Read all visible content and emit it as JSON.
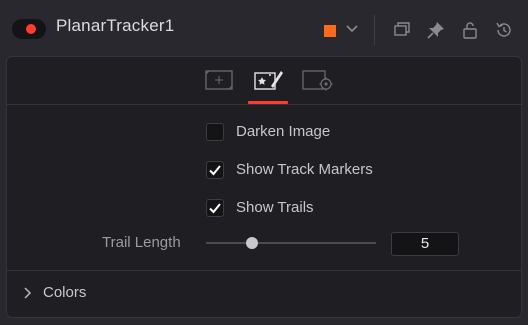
{
  "node": {
    "title": "PlanarTracker1",
    "accent_color": "#ff3b2f",
    "swatch_color": "#ff6a1a"
  },
  "header_icons": [
    "versions-icon",
    "pin-icon",
    "lock-icon",
    "reset-icon"
  ],
  "tabs": [
    {
      "name": "tab-controls-icon",
      "active": false
    },
    {
      "name": "tab-effects-icon",
      "active": true
    },
    {
      "name": "tab-settings-icon",
      "active": false
    }
  ],
  "options": {
    "darken_image": {
      "label": "Darken Image",
      "checked": false
    },
    "show_track_markers": {
      "label": "Show Track Markers",
      "checked": true
    },
    "show_trails": {
      "label": "Show Trails",
      "checked": true
    }
  },
  "trail_length": {
    "label": "Trail Length",
    "value": "5",
    "fraction": 0.27
  },
  "colors_section": {
    "label": "Colors",
    "expanded": false
  }
}
